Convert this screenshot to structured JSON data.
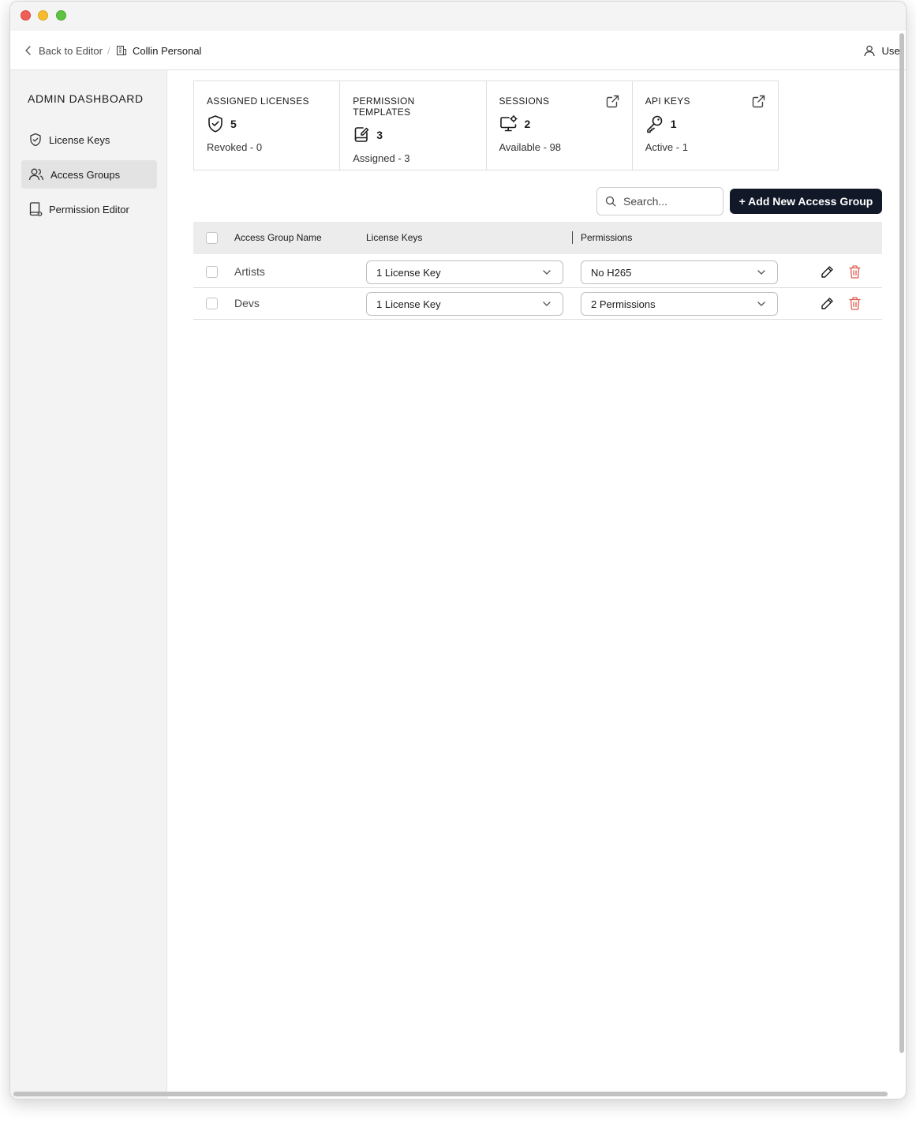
{
  "topbar": {
    "back_label": "Back to Editor",
    "separator": "/",
    "org_name": "Collin Personal",
    "user_label": "User"
  },
  "sidebar": {
    "title": "ADMIN DASHBOARD",
    "items": [
      {
        "label": "License Keys",
        "icon": "shield-check-icon",
        "active": false
      },
      {
        "label": "Access Groups",
        "icon": "users-icon",
        "active": true
      },
      {
        "label": "Permission Editor",
        "icon": "permission-doc-icon",
        "active": false
      }
    ]
  },
  "stats": [
    {
      "label": "ASSIGNED LICENSES",
      "value": "5",
      "sub": "Revoked - 0",
      "icon": "shield-check-icon"
    },
    {
      "label": "PERMISSION TEMPLATES",
      "value": "3",
      "sub": "Assigned - 3",
      "icon": "document-edit-icon"
    },
    {
      "label": "SESSIONS",
      "value": "2",
      "sub": "Available - 98",
      "icon": "monitor-gear-icon",
      "external_link": true
    },
    {
      "label": "API KEYS",
      "value": "1",
      "sub": "Active - 1",
      "icon": "key-icon",
      "external_link": true
    }
  ],
  "search": {
    "placeholder": "Search..."
  },
  "add_button_label": "+ Add New Access Group",
  "table": {
    "headers": {
      "name": "Access Group Name",
      "license_keys": "License Keys",
      "permissions": "Permissions"
    },
    "rows": [
      {
        "name": "Artists",
        "license_keys": "1 License Key",
        "permissions": "No H265"
      },
      {
        "name": "Devs",
        "license_keys": "1 License Key",
        "permissions": "2 Permissions"
      }
    ]
  },
  "colors": {
    "primary_button": "#111827",
    "delete_icon": "#e05a4e",
    "sidebar_bg": "#f3f3f3",
    "sidebar_active": "#e3e3e3"
  }
}
